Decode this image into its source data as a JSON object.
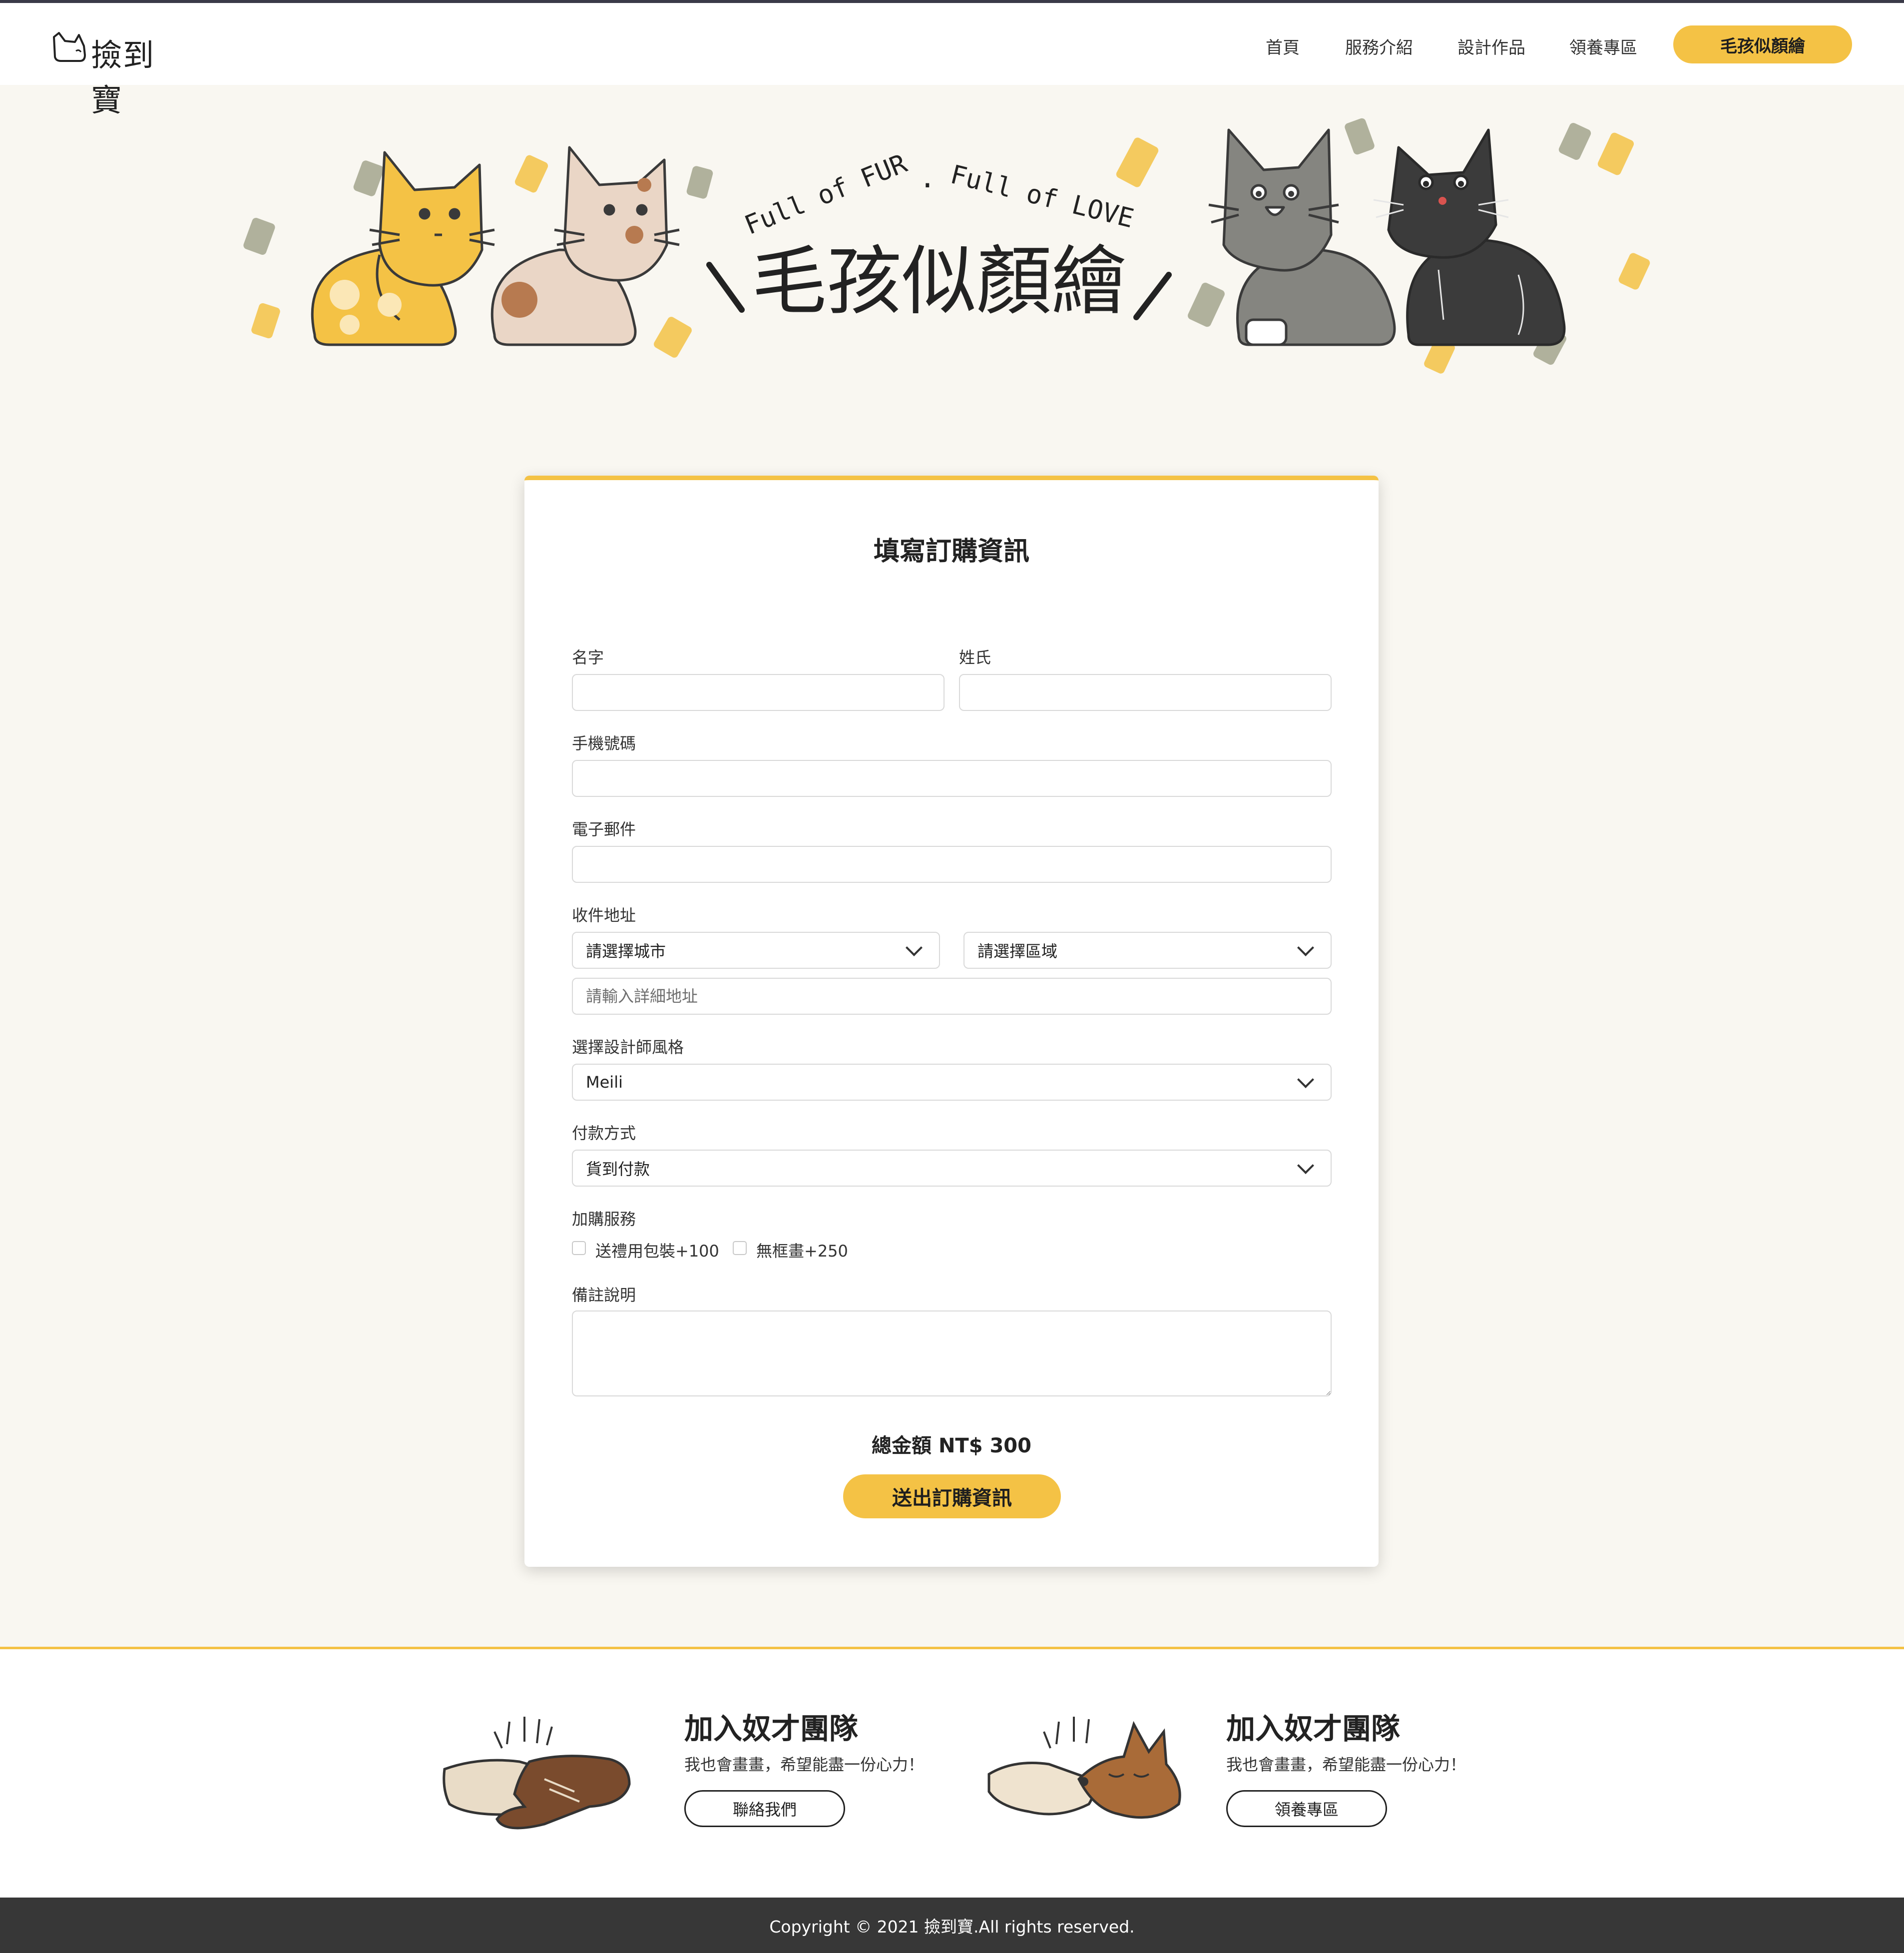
{
  "brand": {
    "logo_text": "撿到寶"
  },
  "nav": {
    "links": [
      "首頁",
      "服務介紹",
      "設計作品",
      "領養專區"
    ],
    "cta": "毛孩似顏繪"
  },
  "hero": {
    "tagline_left": "Full of FUR",
    "tagline_dot": ".",
    "tagline_right": "Full of LOVE",
    "title": "毛孩似顏繪"
  },
  "form": {
    "title": "填寫訂購資訊",
    "first_name_label": "名字",
    "last_name_label": "姓氏",
    "phone_label": "手機號碼",
    "email_label": "電子郵件",
    "address_label": "收件地址",
    "city_select": "請選擇城市",
    "district_select": "請選擇區域",
    "address_placeholder": "請輸入詳細地址",
    "designer_label": "選擇設計師風格",
    "designer_value": "Meili",
    "payment_label": "付款方式",
    "payment_value": "貨到付款",
    "addon_label": "加購服務",
    "addons": [
      "送禮用包裝+100",
      "無框畫+250"
    ],
    "notes_label": "備註說明",
    "total": "總金額 NT$ 300",
    "submit": "送出訂購資訊"
  },
  "footer": {
    "blocks": [
      {
        "title": "加入奴才團隊",
        "desc": "我也會畫畫，希望能盡一份心力！",
        "button": "聯絡我們"
      },
      {
        "title": "加入奴才團隊",
        "desc": "我也會畫畫，希望能盡一份心力！",
        "button": "領養專區"
      }
    ],
    "copyright": "Copyright © 2021 撿到寶.All rights reserved."
  },
  "colors": {
    "accent": "#f4c245",
    "dark": "#373737",
    "background": "#f9f7f1"
  }
}
